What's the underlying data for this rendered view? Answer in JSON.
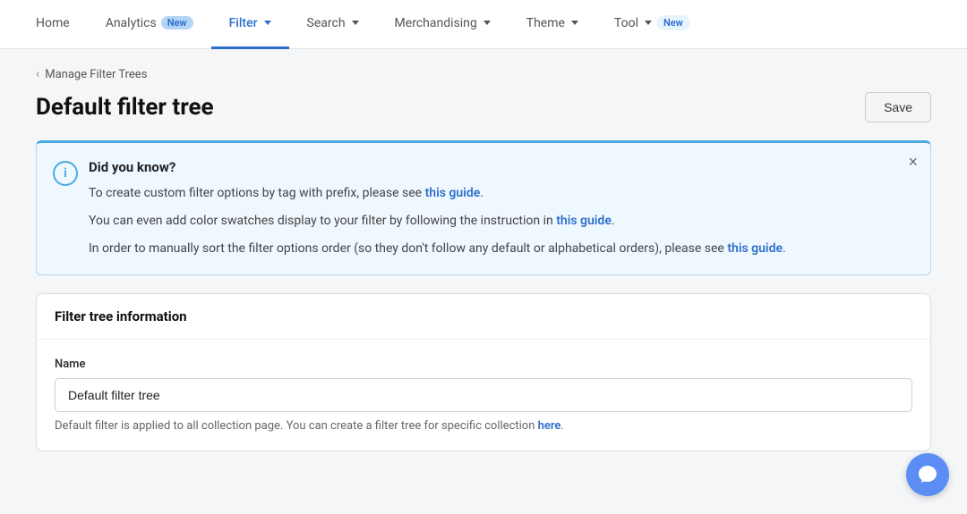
{
  "nav": {
    "items": [
      {
        "id": "home",
        "label": "Home",
        "badge": null,
        "active": false,
        "hasDropdown": false
      },
      {
        "id": "analytics",
        "label": "Analytics",
        "badge": "New",
        "active": false,
        "hasDropdown": false
      },
      {
        "id": "filter",
        "label": "Filter",
        "badge": null,
        "active": true,
        "hasDropdown": true
      },
      {
        "id": "search",
        "label": "Search",
        "badge": null,
        "active": false,
        "hasDropdown": true
      },
      {
        "id": "merchandising",
        "label": "Merchandising",
        "badge": null,
        "active": false,
        "hasDropdown": true
      },
      {
        "id": "theme",
        "label": "Theme",
        "badge": null,
        "active": false,
        "hasDropdown": true
      },
      {
        "id": "tool",
        "label": "Tool",
        "badge": "New",
        "active": false,
        "hasDropdown": true
      }
    ]
  },
  "breadcrumb": {
    "back_label": "Manage Filter Trees"
  },
  "page": {
    "title": "Default filter tree",
    "save_label": "Save"
  },
  "info_box": {
    "title": "Did you know?",
    "lines": [
      {
        "text_before": "To create custom filter options by tag with prefix, please see ",
        "link_text": "this guide",
        "text_after": "."
      },
      {
        "text_before": "You can even add color swatches display to your filter by following the instruction in ",
        "link_text": "this guide",
        "text_after": "."
      },
      {
        "text_before": "In order to manually sort the filter options order (so they don't follow any default or alphabetical orders), please see ",
        "link_text": "this guide",
        "text_after": "."
      }
    ]
  },
  "card": {
    "header": "Filter tree information",
    "name_label": "Name",
    "name_value": "Default filter tree",
    "hint_text": "Default filter is applied to all collection page. You can create a filter tree for specific collection ",
    "hint_link": "here",
    "hint_end": "."
  }
}
